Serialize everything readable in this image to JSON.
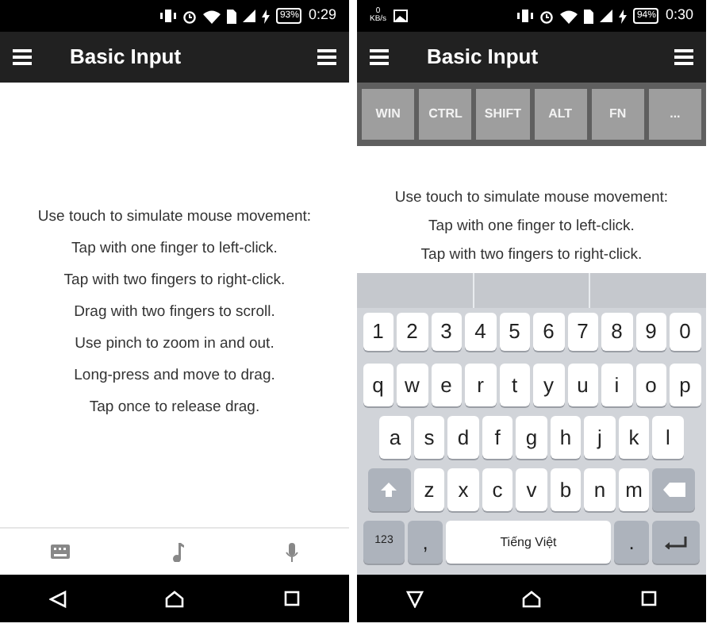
{
  "phones": [
    {
      "status_bar": {
        "battery": "93%",
        "time": "0:29"
      },
      "app_bar": {
        "title": "Basic Input"
      },
      "instructions": [
        "Use touch to simulate mouse movement:",
        "Tap with one finger to left-click.",
        "Tap with two fingers to right-click.",
        "Drag with two fingers to scroll.",
        "Use pinch to zoom in and out.",
        "Long-press and move to drag.",
        "Tap once to release drag."
      ],
      "panel": {
        "kind": "toolbar"
      }
    },
    {
      "status_bar": {
        "speed_value": "0",
        "speed_unit": "KB/s",
        "battery": "94%",
        "time": "0:30"
      },
      "app_bar": {
        "title": "Basic Input"
      },
      "modifier_keys": [
        "WIN",
        "CTRL",
        "SHIFT",
        "ALT",
        "FN",
        "..."
      ],
      "instructions": [
        "Use touch to simulate mouse movement:",
        "Tap with one finger to left-click.",
        "Tap with two fingers to right-click."
      ],
      "panel": {
        "kind": "keyboard",
        "rows": [
          {
            "keys": [
              {
                "kind": "char",
                "label": "1"
              },
              {
                "kind": "char",
                "label": "2"
              },
              {
                "kind": "char",
                "label": "3"
              },
              {
                "kind": "char",
                "label": "4"
              },
              {
                "kind": "char",
                "label": "5"
              },
              {
                "kind": "char",
                "label": "6"
              },
              {
                "kind": "char",
                "label": "7"
              },
              {
                "kind": "char",
                "label": "8"
              },
              {
                "kind": "char",
                "label": "9"
              },
              {
                "kind": "char",
                "label": "0"
              }
            ]
          },
          {
            "keys": [
              {
                "kind": "char",
                "label": "q"
              },
              {
                "kind": "char",
                "label": "w"
              },
              {
                "kind": "char",
                "label": "e"
              },
              {
                "kind": "char",
                "label": "r"
              },
              {
                "kind": "char",
                "label": "t"
              },
              {
                "kind": "char",
                "label": "y"
              },
              {
                "kind": "char",
                "label": "u"
              },
              {
                "kind": "char",
                "label": "i"
              },
              {
                "kind": "char",
                "label": "o"
              },
              {
                "kind": "char",
                "label": "p"
              }
            ]
          },
          {
            "keys": [
              {
                "kind": "char",
                "label": "a"
              },
              {
                "kind": "char",
                "label": "s"
              },
              {
                "kind": "char",
                "label": "d"
              },
              {
                "kind": "char",
                "label": "f"
              },
              {
                "kind": "char",
                "label": "g"
              },
              {
                "kind": "char",
                "label": "h"
              },
              {
                "kind": "char",
                "label": "j"
              },
              {
                "kind": "char",
                "label": "k"
              },
              {
                "kind": "char",
                "label": "l"
              }
            ]
          },
          {
            "keys": [
              {
                "kind": "shift"
              },
              {
                "kind": "char",
                "label": "z"
              },
              {
                "kind": "char",
                "label": "x"
              },
              {
                "kind": "char",
                "label": "c"
              },
              {
                "kind": "char",
                "label": "v"
              },
              {
                "kind": "char",
                "label": "b"
              },
              {
                "kind": "char",
                "label": "n"
              },
              {
                "kind": "char",
                "label": "m"
              },
              {
                "kind": "backspace"
              }
            ]
          },
          {
            "keys": [
              {
                "kind": "mode",
                "label": "123"
              },
              {
                "kind": "punct",
                "label": ","
              },
              {
                "kind": "space",
                "label": "Tiếng Việt"
              },
              {
                "kind": "punct",
                "label": "."
              },
              {
                "kind": "enter"
              }
            ]
          }
        ]
      }
    }
  ]
}
